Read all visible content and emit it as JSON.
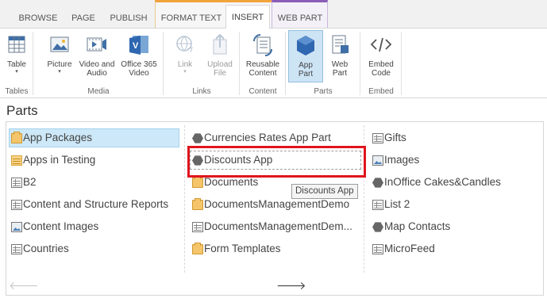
{
  "tabs": [
    "BROWSE",
    "PAGE",
    "PUBLISH",
    "FORMAT TEXT",
    "INSERT",
    "WEB PART"
  ],
  "ribbon": {
    "groups": {
      "tables": "Tables",
      "media": "Media",
      "links": "Links",
      "content": "Content",
      "parts": "Parts",
      "embed": "Embed"
    },
    "buttons": {
      "table": "Table",
      "picture": "Picture",
      "video_audio_1": "Video and",
      "video_audio_2": "Audio",
      "office365_1": "Office 365",
      "office365_2": "Video",
      "link": "Link",
      "upload_1": "Upload",
      "upload_2": "File",
      "reusable_1": "Reusable",
      "reusable_2": "Content",
      "apppart_1": "App",
      "apppart_2": "Part",
      "webpart_1": "Web",
      "webpart_2": "Part",
      "embed_1": "Embed",
      "embed_2": "Code"
    }
  },
  "parts": {
    "title": "Parts",
    "col1": [
      "App Packages",
      "Apps in Testing",
      "B2",
      "Content and Structure Reports",
      "Content Images",
      "Countries"
    ],
    "col2": [
      "Currencies Rates App Part",
      "Discounts App",
      "Documents",
      "DocumentsManagementDemo",
      "DocumentsManagementDem...",
      "Form Templates"
    ],
    "col3": [
      "Gifts",
      "Images",
      "InOffice Cakes&Candles",
      "List 2",
      "Map Contacts",
      "MicroFeed"
    ],
    "tooltip": "Discounts App",
    "selected": "App Packages"
  },
  "icons": {
    "col1": [
      "folder-icon",
      "table-list-icon",
      "list-icon",
      "list-icon",
      "image-library-icon",
      "list-icon"
    ],
    "col2": [
      "app-icon",
      "app-icon",
      "folder-icon",
      "folder-icon",
      "list-icon",
      "folder-icon"
    ],
    "col3": [
      "list-icon",
      "image-library-icon",
      "app-icon",
      "list-icon",
      "app-icon",
      "list-icon"
    ]
  },
  "colors": {
    "format_text_accent": "#f2a33a",
    "web_part_accent": "#8b5db8",
    "selection": "#cde8f8",
    "highlight_red": "#e0141e"
  }
}
